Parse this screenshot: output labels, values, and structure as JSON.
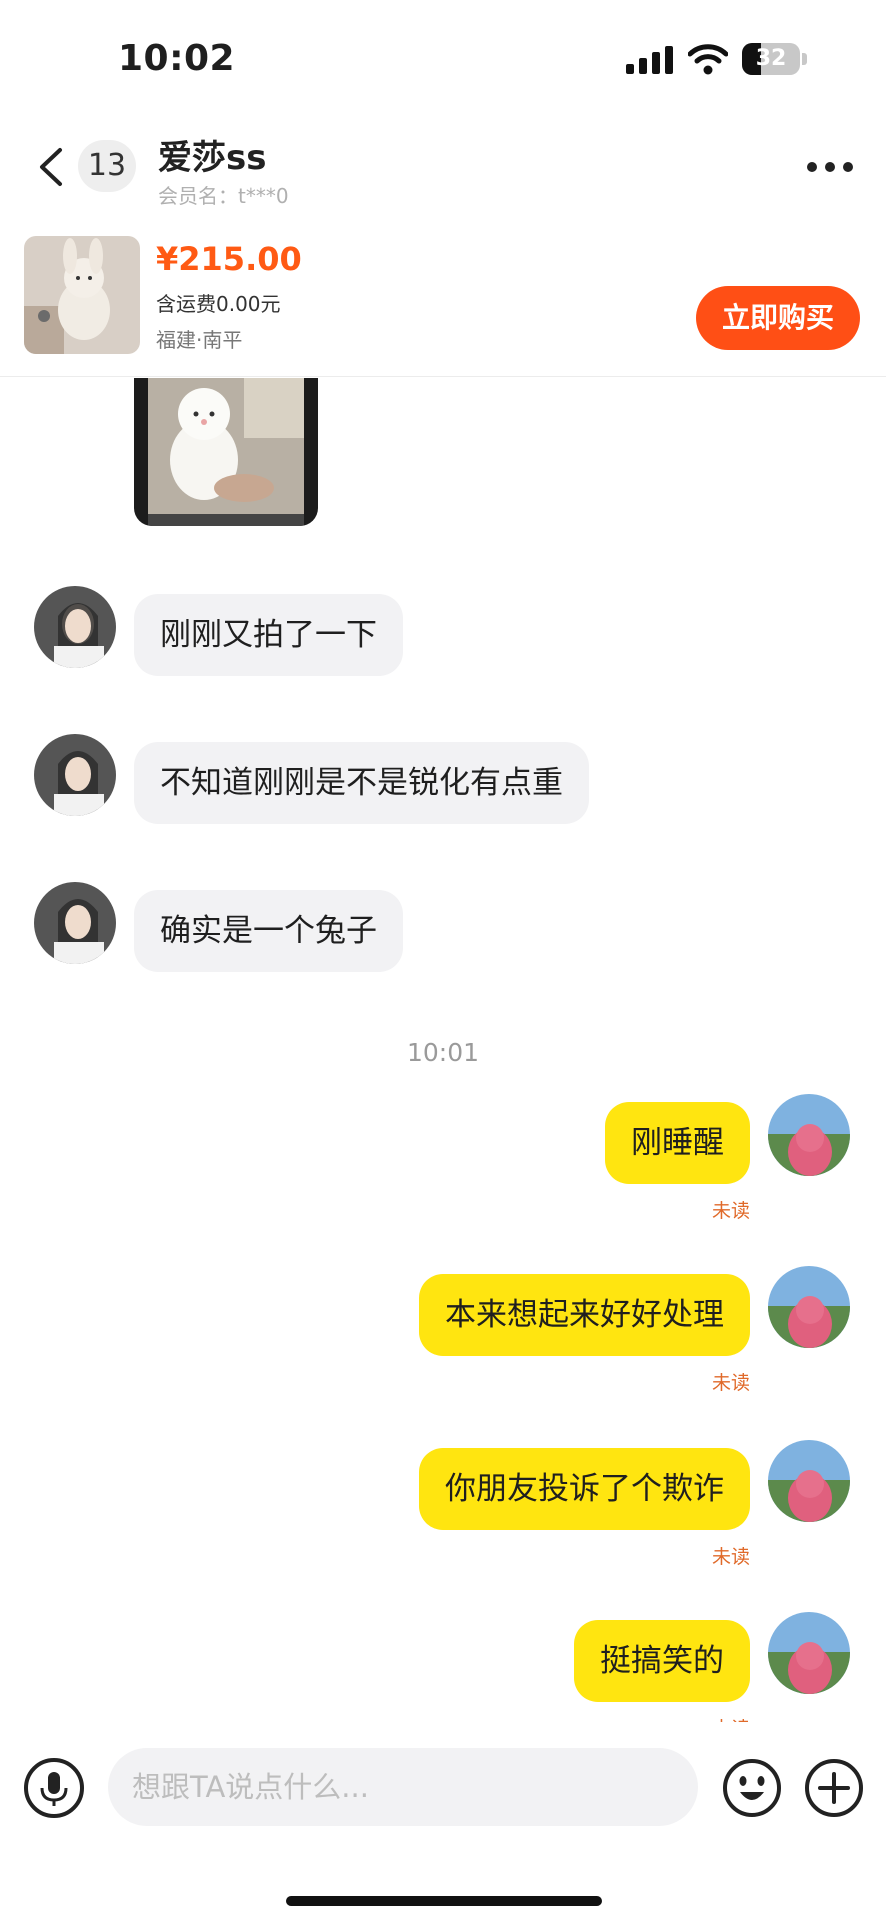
{
  "status_bar": {
    "time": "10:02",
    "battery_level": "32",
    "battery_fraction": 0.32
  },
  "header": {
    "unread_count": "13",
    "contact_name": "爱莎ss",
    "member_label": "会员名：t***0"
  },
  "product": {
    "price": "¥215.00",
    "shipping": "含运费0.00元",
    "location": "福建·南平",
    "buy_label": "立即购买"
  },
  "messages_in": [
    {
      "text": "刚刚又拍了一下"
    },
    {
      "text": "不知道刚刚是不是锐化有点重"
    },
    {
      "text": "确实是一个兔子"
    }
  ],
  "divider_time": "10:01",
  "messages_out": [
    {
      "text": "刚睡醒",
      "status": "未读"
    },
    {
      "text": "本来想起来好好处理",
      "status": "未读"
    },
    {
      "text": "你朋友投诉了个欺诈",
      "status": "未读"
    },
    {
      "text": "挺搞笑的",
      "status": "未读"
    }
  ],
  "input": {
    "placeholder": "想跟TA说点什么..."
  },
  "colors": {
    "accent": "#ff4f15",
    "price": "#ff5a14",
    "out_bubble": "#ffe510",
    "in_bubble": "#f2f2f4",
    "unread": "#e06a2a"
  },
  "icons": [
    "back-icon",
    "more-icon",
    "signal-icon",
    "wifi-icon",
    "battery-icon",
    "microphone-icon",
    "emoji-icon",
    "plus-icon"
  ]
}
